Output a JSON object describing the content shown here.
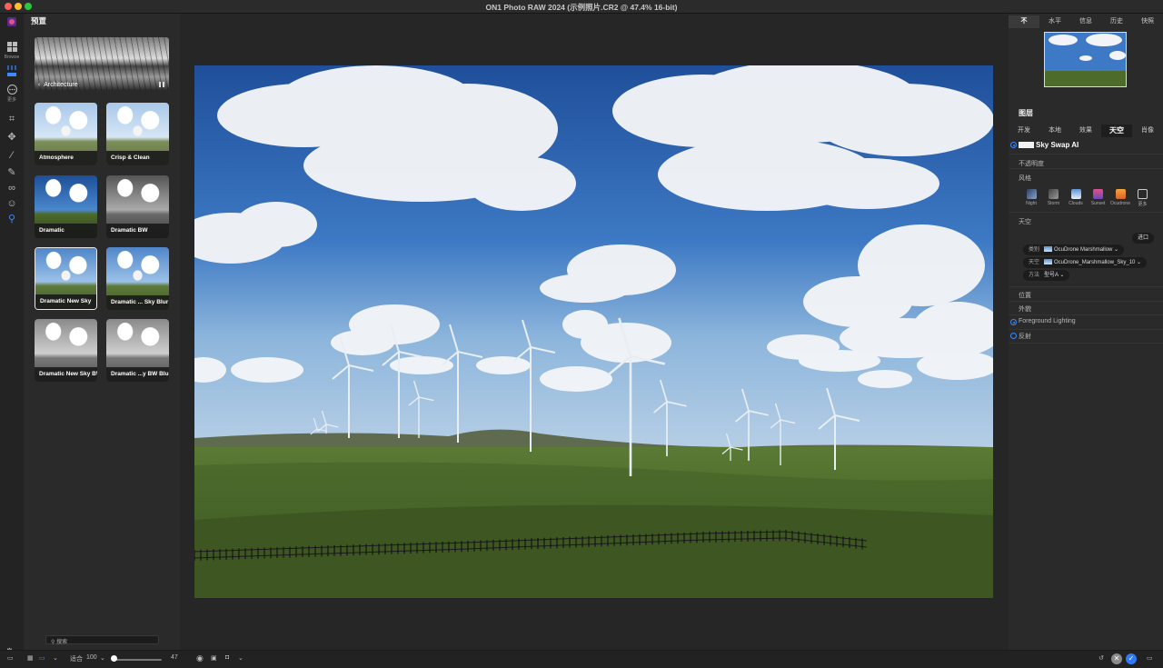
{
  "window": {
    "title": "ON1 Photo RAW 2024 (示例照片.CR2 @ 47.4% 16-bit)"
  },
  "toolrail": {
    "browse_label": "Browse",
    "more_label": "更多"
  },
  "presets": {
    "title": "预置",
    "category": "Architecture",
    "items": [
      {
        "label": "Atmosphere",
        "style": "light"
      },
      {
        "label": "Crisp & Clean",
        "style": "light"
      },
      {
        "label": "Dramatic",
        "style": "dark"
      },
      {
        "label": "Dramatic BW",
        "style": "bw"
      },
      {
        "label": "Dramatic New Sky",
        "style": "color",
        "selected": true
      },
      {
        "label": "Dramatic ... Sky Blur",
        "style": "color"
      },
      {
        "label": "Dramatic New Sky BW",
        "style": "bwlight"
      },
      {
        "label": "Dramatic ...y BW Blur",
        "style": "bwlight"
      }
    ],
    "search_placeholder": "搜索"
  },
  "right_panel": {
    "top_tabs": [
      "不",
      "水平",
      "信息",
      "历史",
      "快照"
    ],
    "active_top_tab": 0,
    "layers_title": "图层",
    "module_tabs": [
      "开发",
      "本地",
      "效果",
      "天空",
      "肖像"
    ],
    "active_module_tab": 3,
    "sky_swap": {
      "title": "Sky Swap AI",
      "opacity_label": "不透明度",
      "style_label": "风格",
      "styles": [
        "Night",
        "Storm",
        "Clouds",
        "Sunset",
        "Ocudrone",
        "更多"
      ],
      "sky_label": "天空",
      "import_button": "进口",
      "category_key": "类别",
      "category_value": "OcuDrone Marshmallow",
      "sky_key": "天空",
      "sky_value": "OcuDrone_Marshmallow_Sky_10",
      "method_key": "方法",
      "method_value": "型号A",
      "position_label": "位置",
      "appearance_label": "外貌",
      "foreground_lighting_label": "Foreground Lighting",
      "reflection_label": "反射"
    }
  },
  "bottombar": {
    "fit_label": "适合",
    "zoom_value": "100",
    "slider_value": "47"
  },
  "colors": {
    "accent": "#3d8bff",
    "panel": "#2a2a2a",
    "background": "#1e1e1e"
  }
}
